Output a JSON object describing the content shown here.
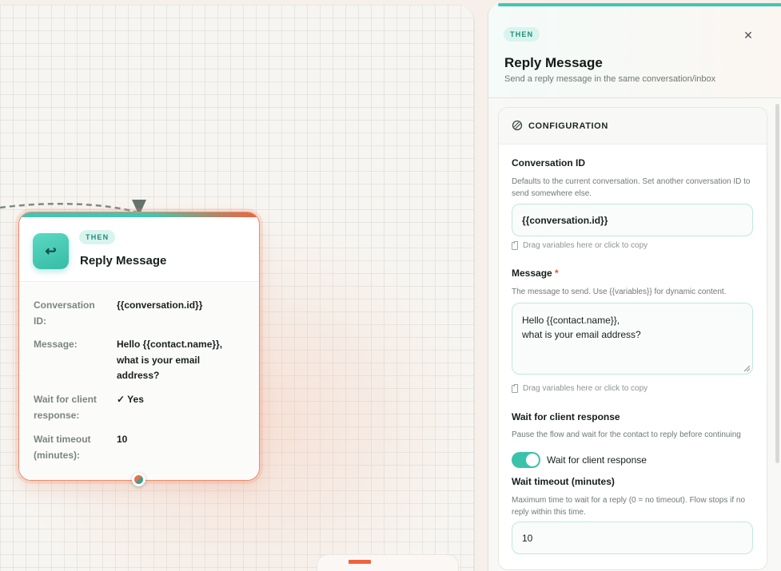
{
  "node": {
    "badge": "THEN",
    "icon": "reply-arrow-icon",
    "icon_glyph": "↩",
    "title": "Reply Message",
    "fields": [
      {
        "key": "Conversation ID:",
        "value": "{{conversation.id}}"
      },
      {
        "key": "Message:",
        "value": "Hello {{contact.name}}, what is your email address?"
      },
      {
        "key": "Wait for client response:",
        "value": "✓ Yes"
      },
      {
        "key": "Wait timeout (minutes):",
        "value": "10"
      }
    ]
  },
  "panel": {
    "badge": "THEN",
    "close_glyph": "✕",
    "title": "Reply Message",
    "subtitle": "Send a reply message in the same conversation/inbox",
    "section_label": "CONFIGURATION",
    "conversation_id": {
      "label": "Conversation ID",
      "help": "Defaults to the current conversation. Set another conversation ID to send somewhere else.",
      "value": "{{conversation.id}}",
      "hint": "Drag variables here or click to copy"
    },
    "message": {
      "label": "Message",
      "required_mark": "*",
      "help": "The message to send. Use {{variables}} for dynamic content.",
      "value": "Hello {{contact.name}},\nwhat is your email address?",
      "hint": "Drag variables here or click to copy"
    },
    "wait_response": {
      "label": "Wait for client response",
      "help": "Pause the flow and wait for the contact to reply before continuing",
      "toggle_label": "Wait for client response",
      "enabled": true
    },
    "wait_timeout": {
      "label": "Wait timeout (minutes)",
      "help": "Maximum time to wait for a reply (0 = no timeout). Flow stops if no reply within this time.",
      "value": "10"
    }
  },
  "colors": {
    "accent_teal": "#43c5b0",
    "accent_orange": "#f0623d"
  }
}
